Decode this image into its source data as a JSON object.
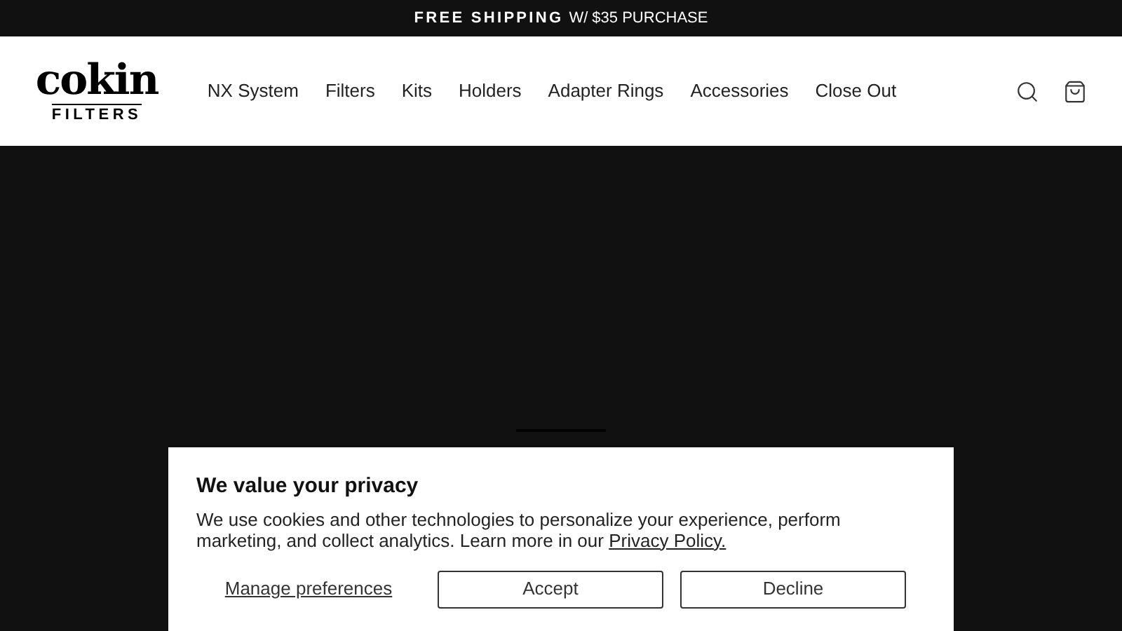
{
  "announcement": {
    "bold": "FREE SHIPPING",
    "text": "W/ $35 PURCHASE"
  },
  "logo": {
    "brand": "cokin",
    "sub": "FILTERS"
  },
  "nav": [
    "NX System",
    "Filters",
    "Kits",
    "Holders",
    "Adapter Rings",
    "Accessories",
    "Close Out"
  ],
  "hero": {
    "slides": [
      {
        "selected": true
      }
    ]
  },
  "cookie_banner": {
    "title": "We value your privacy",
    "text": "We use cookies and other technologies to personalize your experience, perform marketing, and collect analytics. Learn more in our",
    "link": "Privacy Policy.",
    "manage": "Manage preferences",
    "buttons": [
      "Accept",
      "Decline"
    ]
  }
}
